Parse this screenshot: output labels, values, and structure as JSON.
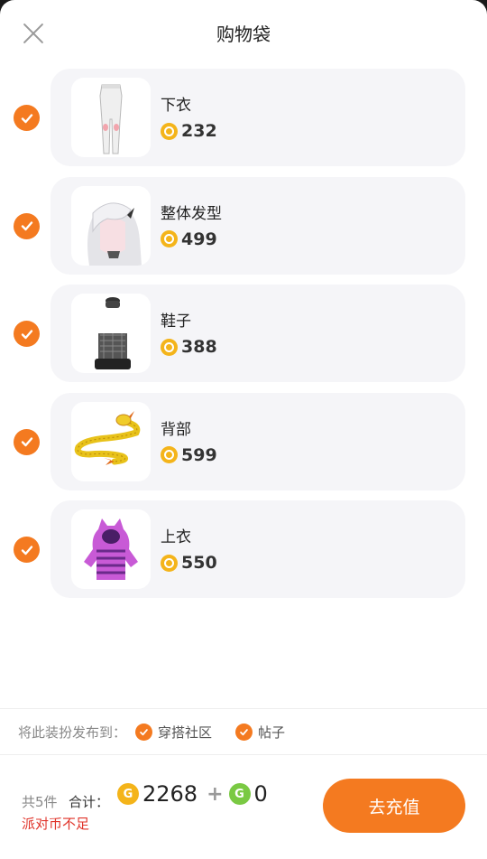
{
  "header": {
    "title": "购物袋"
  },
  "items": [
    {
      "name": "下衣",
      "price": "232",
      "image": "pants"
    },
    {
      "name": "整体发型",
      "price": "499",
      "image": "white-hair"
    },
    {
      "name": "鞋子",
      "price": "388",
      "image": "platform-boots"
    },
    {
      "name": "背部",
      "price": "599",
      "image": "golden-dragon"
    },
    {
      "name": "上衣",
      "price": "550",
      "image": "purple-hoodie"
    }
  ],
  "publish": {
    "label": "将此装扮发布到：",
    "options": [
      {
        "label": "穿搭社区",
        "checked": true
      },
      {
        "label": "帖子",
        "checked": true
      }
    ]
  },
  "footer": {
    "count": "共5件",
    "total_label": "合计：",
    "gold_total": "2268",
    "plus": "+",
    "green_total": "0",
    "gold_coin_letter": "G",
    "green_coin_letter": "G",
    "insufficient": "派对币不足",
    "recharge_label": "去充值"
  },
  "colors": {
    "accent": "#f47a20",
    "coin_gold": "#f4b41a",
    "coin_green": "#7ac943",
    "warning": "#e0342a",
    "card_bg": "#f5f5f8"
  }
}
